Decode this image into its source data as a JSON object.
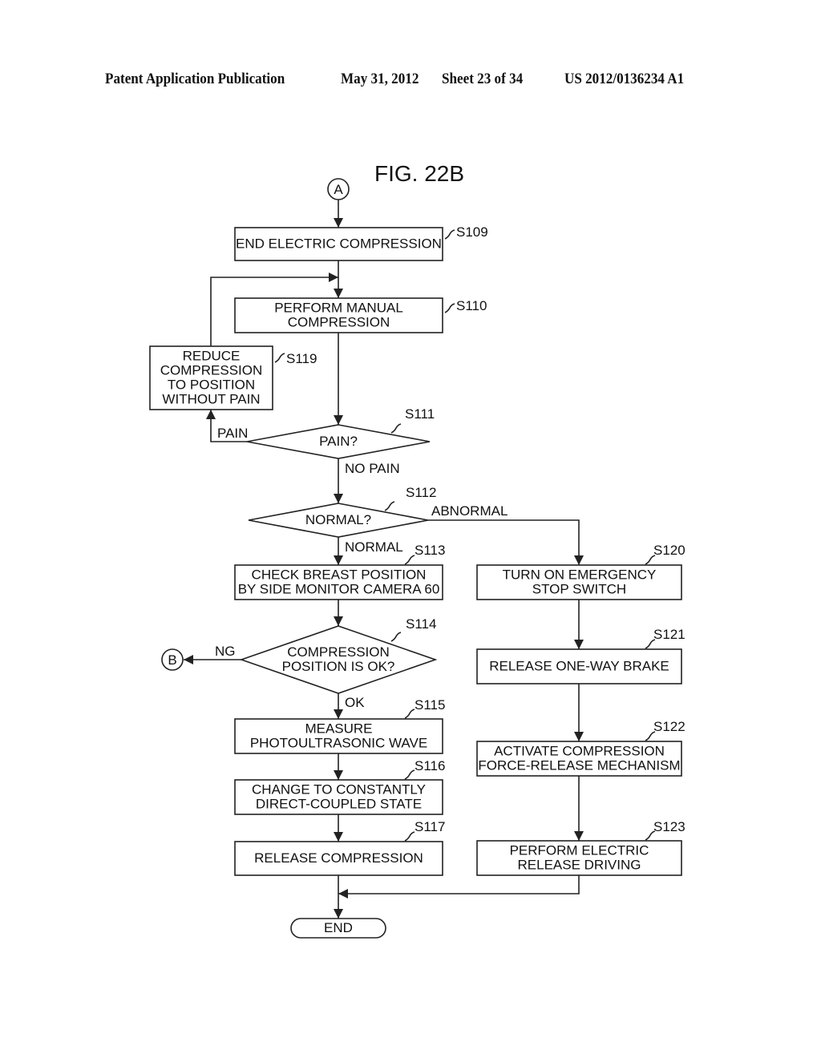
{
  "header": {
    "publication": "Patent Application Publication",
    "date": "May 31, 2012",
    "sheet": "Sheet 23 of 34",
    "number": "US 2012/0136234 A1"
  },
  "figure": {
    "title": "FIG. 22B",
    "connectors": {
      "in": "A",
      "out": "B"
    },
    "steps": {
      "s109": {
        "id": "S109",
        "lines": [
          "END ELECTRIC COMPRESSION"
        ]
      },
      "s110": {
        "id": "S110",
        "lines": [
          "PERFORM MANUAL",
          "COMPRESSION"
        ]
      },
      "s119": {
        "id": "S119",
        "lines": [
          "REDUCE",
          "COMPRESSION",
          "TO POSITION",
          "WITHOUT PAIN"
        ]
      },
      "s111": {
        "id": "S111",
        "lines": [
          "PAIN?"
        ]
      },
      "s112": {
        "id": "S112",
        "lines": [
          "NORMAL?"
        ]
      },
      "s113": {
        "id": "S113",
        "lines": [
          "CHECK BREAST POSITION",
          "BY SIDE MONITOR CAMERA 60"
        ]
      },
      "s114": {
        "id": "S114",
        "lines": [
          "COMPRESSION",
          "POSITION IS OK?"
        ]
      },
      "s115": {
        "id": "S115",
        "lines": [
          "MEASURE",
          "PHOTOULTRASONIC WAVE"
        ]
      },
      "s116": {
        "id": "S116",
        "lines": [
          "CHANGE TO CONSTANTLY",
          "DIRECT-COUPLED STATE"
        ]
      },
      "s117": {
        "id": "S117",
        "lines": [
          "RELEASE COMPRESSION"
        ]
      },
      "s120": {
        "id": "S120",
        "lines": [
          "TURN ON EMERGENCY",
          "STOP SWITCH"
        ]
      },
      "s121": {
        "id": "S121",
        "lines": [
          "RELEASE ONE-WAY BRAKE"
        ]
      },
      "s122": {
        "id": "S122",
        "lines": [
          "ACTIVATE COMPRESSION",
          "FORCE-RELEASE MECHANISM"
        ]
      },
      "s123": {
        "id": "S123",
        "lines": [
          "PERFORM ELECTRIC",
          "RELEASE DRIVING"
        ]
      },
      "end": {
        "lines": [
          "END"
        ]
      }
    },
    "branch_labels": {
      "pain": "PAIN",
      "no_pain": "NO PAIN",
      "normal": "NORMAL",
      "abnormal": "ABNORMAL",
      "ok": "OK",
      "ng": "NG"
    }
  }
}
